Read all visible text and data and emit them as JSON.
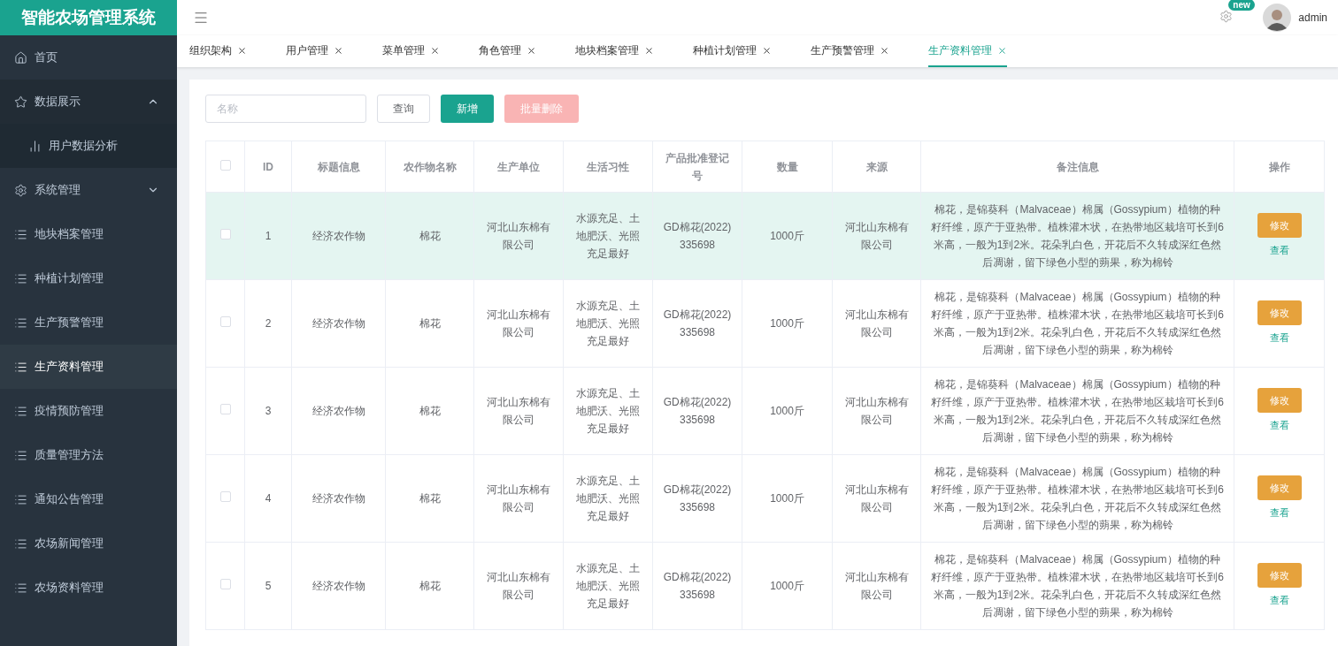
{
  "app_title": "智能农场管理系统",
  "sidebar": {
    "items": [
      {
        "label": "首页",
        "kind": "home",
        "selected": false
      },
      {
        "label": "数据展示",
        "kind": "star",
        "selected": false,
        "expanded": true,
        "children": [
          {
            "label": "用户数据分析",
            "kind": "chart",
            "selected": false
          }
        ]
      },
      {
        "label": "系统管理",
        "kind": "gear",
        "selected": false,
        "expanded": false
      },
      {
        "label": "地块档案管理",
        "kind": "list",
        "selected": false
      },
      {
        "label": "种植计划管理",
        "kind": "list",
        "selected": false
      },
      {
        "label": "生产预警管理",
        "kind": "list",
        "selected": false
      },
      {
        "label": "生产资料管理",
        "kind": "list",
        "selected": true
      },
      {
        "label": "疫情预防管理",
        "kind": "list",
        "selected": false
      },
      {
        "label": "质量管理方法",
        "kind": "list",
        "selected": false
      },
      {
        "label": "通知公告管理",
        "kind": "list",
        "selected": false
      },
      {
        "label": "农场新闻管理",
        "kind": "list",
        "selected": false
      },
      {
        "label": "农场资料管理",
        "kind": "list",
        "selected": false
      }
    ]
  },
  "header": {
    "badge": "new",
    "user": "admin"
  },
  "tabs": [
    {
      "label": "组织架构",
      "selected": false
    },
    {
      "label": "用户管理",
      "selected": false
    },
    {
      "label": "菜单管理",
      "selected": false
    },
    {
      "label": "角色管理",
      "selected": false
    },
    {
      "label": "地块档案管理",
      "selected": false
    },
    {
      "label": "种植计划管理",
      "selected": false
    },
    {
      "label": "生产预警管理",
      "selected": false
    },
    {
      "label": "生产资料管理",
      "selected": true
    }
  ],
  "toolbar": {
    "search": {
      "placeholder": "名称"
    },
    "buttons": [
      {
        "label": "查询",
        "kind": "default",
        "disabled": false
      },
      {
        "label": "新增",
        "kind": "primary",
        "disabled": false
      },
      {
        "label": "批量删除",
        "kind": "danger",
        "disabled": true
      }
    ]
  },
  "table": {
    "all_checked": false,
    "columns": [
      "ID",
      "标题信息",
      "农作物名称",
      "生产单位",
      "生活习性",
      "产品批准登记号",
      "数量",
      "来源",
      "备注信息",
      "操作"
    ],
    "rows": [
      {
        "checked": false,
        "highlighted": true,
        "cells": [
          "1",
          "经济农作物",
          "棉花",
          "河北山东棉有限公司",
          "水源充足、土地肥沃、光照充足最好",
          "GD棉花(2022) 335698",
          "1000斤",
          "河北山东棉有限公司",
          "棉花，是锦葵科（Malvaceae）棉属（Gossypium）植物的种籽纤维，原产于亚热带。植株灌木状，在热带地区栽培可长到6米高，一般为1到2米。花朵乳白色，开花后不久转成深红色然后凋谢，留下绿色小型的蒴果，称为棉铃"
        ],
        "actions": [
          "修改",
          "查看"
        ]
      },
      {
        "checked": false,
        "highlighted": false,
        "cells": [
          "2",
          "经济农作物",
          "棉花",
          "河北山东棉有限公司",
          "水源充足、土地肥沃、光照充足最好",
          "GD棉花(2022) 335698",
          "1000斤",
          "河北山东棉有限公司",
          "棉花，是锦葵科（Malvaceae）棉属（Gossypium）植物的种籽纤维，原产于亚热带。植株灌木状，在热带地区栽培可长到6米高，一般为1到2米。花朵乳白色，开花后不久转成深红色然后凋谢，留下绿色小型的蒴果，称为棉铃"
        ],
        "actions": [
          "修改",
          "查看"
        ]
      },
      {
        "checked": false,
        "highlighted": false,
        "cells": [
          "3",
          "经济农作物",
          "棉花",
          "河北山东棉有限公司",
          "水源充足、土地肥沃、光照充足最好",
          "GD棉花(2022) 335698",
          "1000斤",
          "河北山东棉有限公司",
          "棉花，是锦葵科（Malvaceae）棉属（Gossypium）植物的种籽纤维，原产于亚热带。植株灌木状，在热带地区栽培可长到6米高，一般为1到2米。花朵乳白色，开花后不久转成深红色然后凋谢，留下绿色小型的蒴果，称为棉铃"
        ],
        "actions": [
          "修改",
          "查看"
        ]
      },
      {
        "checked": false,
        "highlighted": false,
        "cells": [
          "4",
          "经济农作物",
          "棉花",
          "河北山东棉有限公司",
          "水源充足、土地肥沃、光照充足最好",
          "GD棉花(2022) 335698",
          "1000斤",
          "河北山东棉有限公司",
          "棉花，是锦葵科（Malvaceae）棉属（Gossypium）植物的种籽纤维，原产于亚热带。植株灌木状，在热带地区栽培可长到6米高，一般为1到2米。花朵乳白色，开花后不久转成深红色然后凋谢，留下绿色小型的蒴果，称为棉铃"
        ],
        "actions": [
          "修改",
          "查看"
        ]
      },
      {
        "checked": false,
        "highlighted": false,
        "cells": [
          "5",
          "经济农作物",
          "棉花",
          "河北山东棉有限公司",
          "水源充足、土地肥沃、光照充足最好",
          "GD棉花(2022) 335698",
          "1000斤",
          "河北山东棉有限公司",
          "棉花，是锦葵科（Malvaceae）棉属（Gossypium）植物的种籽纤维，原产于亚热带。植株灌木状，在热带地区栽培可长到6米高，一般为1到2米。花朵乳白色，开花后不久转成深红色然后凋谢，留下绿色小型的蒴果，称为棉铃"
        ],
        "actions": [
          "修改",
          "查看"
        ]
      }
    ]
  }
}
